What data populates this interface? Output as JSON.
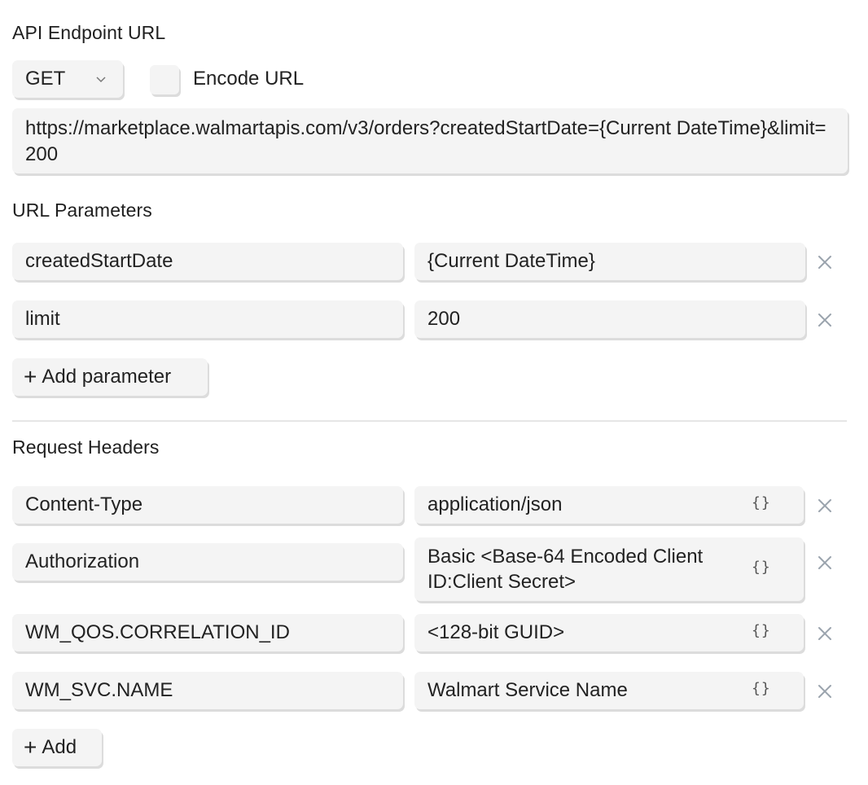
{
  "endpoint": {
    "title": "API Endpoint URL",
    "method": "GET",
    "encode_label": "Encode URL",
    "url": "https://marketplace.walmartapis.com/v3/orders?createdStartDate={Current DateTime}&limit=200"
  },
  "params": {
    "title": "URL Parameters",
    "rows": [
      {
        "key": "createdStartDate",
        "value": "{Current DateTime}"
      },
      {
        "key": "limit",
        "value": "200"
      }
    ],
    "add_label": "Add parameter"
  },
  "headers": {
    "title": "Request Headers",
    "rows": [
      {
        "key": "Content-Type",
        "value": "application/json"
      },
      {
        "key": "Authorization",
        "value": "Basic <Base-64 Encoded Client ID:Client Secret>"
      },
      {
        "key": "WM_QOS.CORRELATION_ID",
        "value": "<128-bit GUID>"
      },
      {
        "key": "WM_SVC.NAME",
        "value": "Walmart Service Name"
      }
    ],
    "brace_glyph": "{}",
    "add_label": "Add"
  },
  "icons": {
    "remove": "close-icon",
    "add": "plus-icon",
    "dropdown": "chevron-down-icon",
    "variable": "braces-icon"
  },
  "colors": {
    "field_bg": "#f4f4f4",
    "icon_gray": "#9aa3ad",
    "divider": "#e6e6e6"
  }
}
